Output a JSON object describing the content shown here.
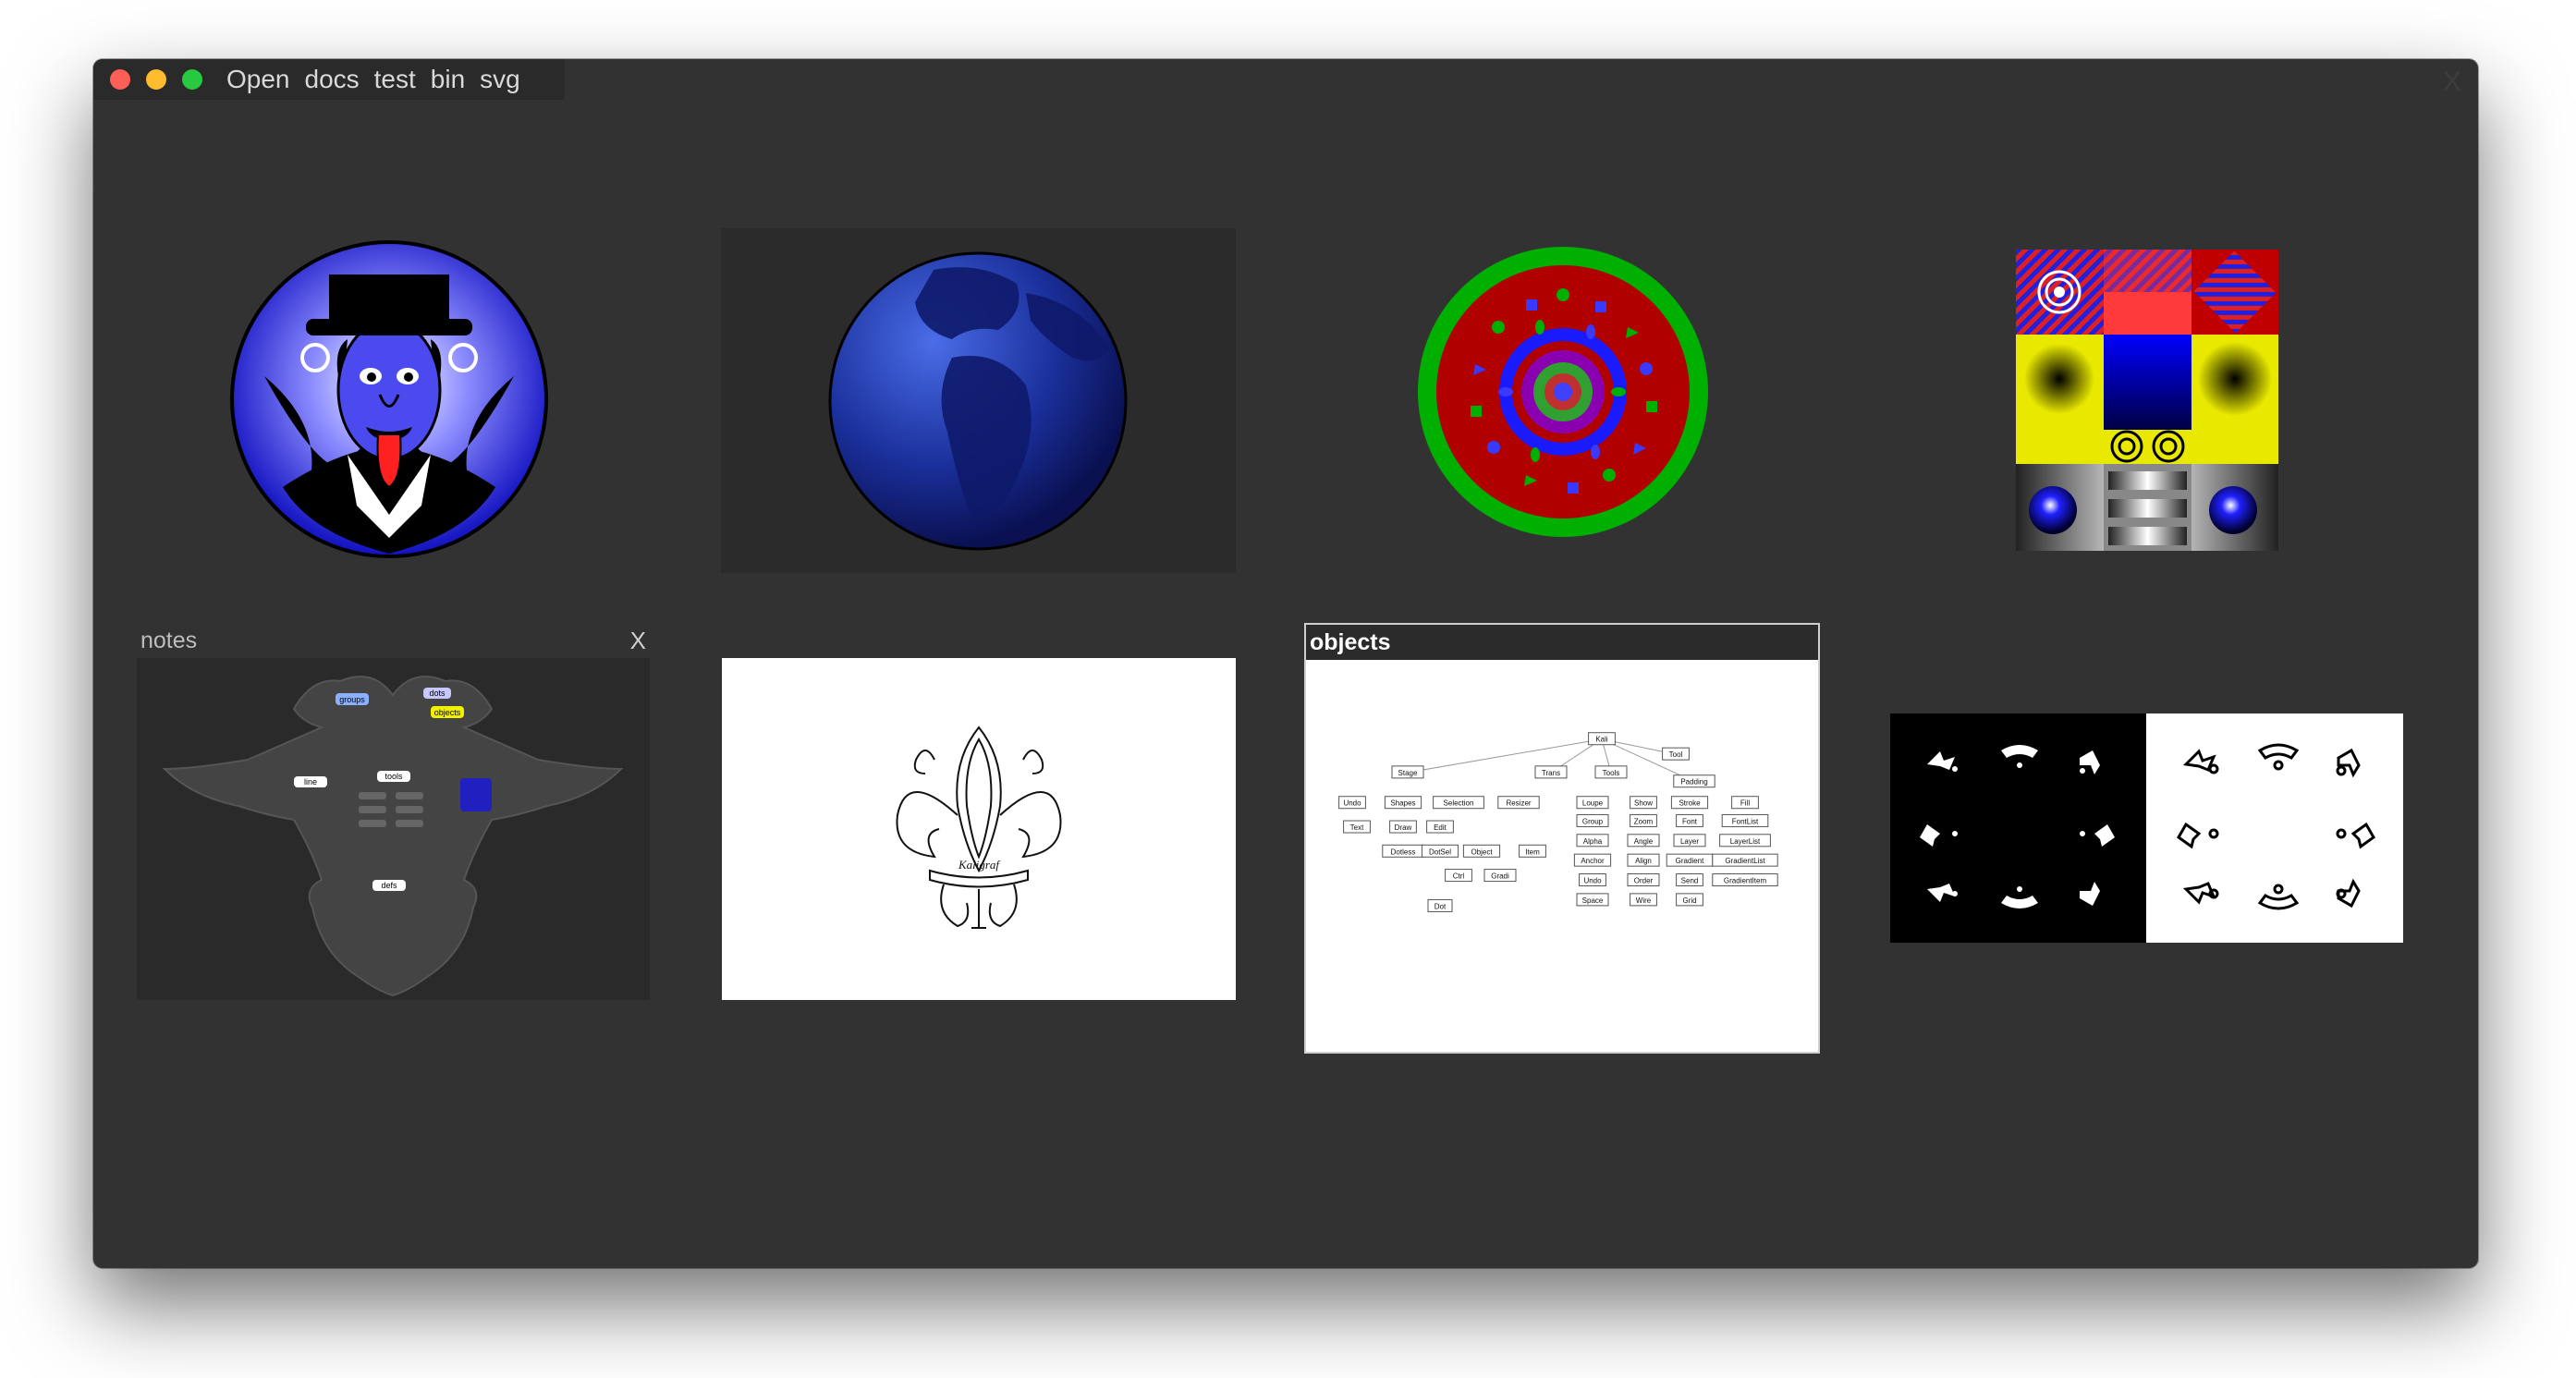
{
  "menu": {
    "items": [
      "Open",
      "docs",
      "test",
      "bin",
      "svg"
    ]
  },
  "window": {
    "close_label": "X"
  },
  "tiles": {
    "notes": {
      "title": "notes",
      "close_label": "X",
      "nodes": [
        "groups",
        "dots",
        "objects",
        "line",
        "tools",
        "defs"
      ]
    },
    "objects": {
      "title": "objects",
      "nodes": [
        "Kali",
        "Tool",
        "Stage",
        "Trans",
        "Tools",
        "Padding",
        "Undo",
        "Shapes",
        "Selection",
        "Resizer",
        "Loupe",
        "Show",
        "Stroke",
        "Fill",
        "Text",
        "Draw",
        "Edit",
        "Group",
        "Zoom",
        "Font",
        "FontList",
        "Dotless",
        "DotSel",
        "Object",
        "Item",
        "Alpha",
        "Angle",
        "Layer",
        "LayerList",
        "Ctrl",
        "Gradi",
        "Anchor",
        "Align",
        "Gradient",
        "GradientList",
        "Dot",
        "Undo",
        "Order",
        "Send",
        "GradientItem",
        "Space",
        "Wire",
        "Grid"
      ]
    },
    "fleur": {
      "signature": "Kaligraf"
    }
  },
  "colors": {
    "window_bg": "#323232",
    "titlebar_bg": "#2a2a2a",
    "menu_text": "#d9d9d9",
    "traffic_red": "#ff5f57",
    "traffic_yellow": "#febc2e",
    "traffic_green": "#28c840"
  },
  "icons": [
    "close-traffic-light",
    "minimize-traffic-light",
    "zoom-traffic-light"
  ]
}
